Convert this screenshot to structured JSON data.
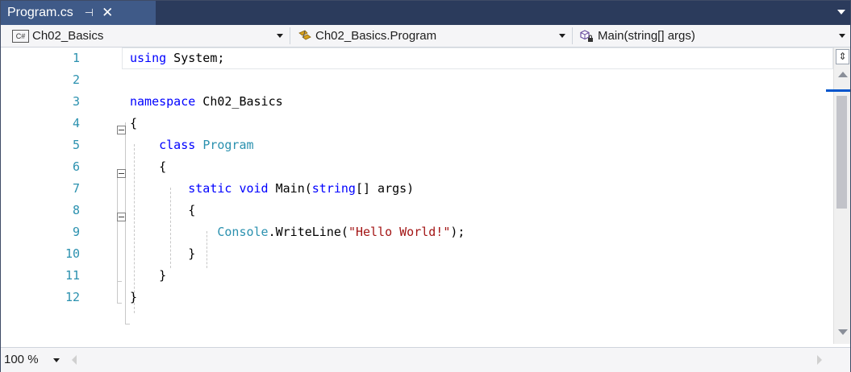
{
  "tab": {
    "title": "Program.cs",
    "pin_glyph": "⊣",
    "close_glyph": "✕"
  },
  "nav": {
    "project": {
      "icon": "csharp-project-icon",
      "badge": "C#",
      "label": "Ch02_Basics"
    },
    "type": {
      "icon": "class-icon",
      "label": "Ch02_Basics.Program"
    },
    "member": {
      "icon": "method-icon",
      "label": "Main(string[] args)"
    }
  },
  "editor": {
    "line_numbers": [
      "1",
      "2",
      "3",
      "4",
      "5",
      "6",
      "7",
      "8",
      "9",
      "10",
      "11",
      "12"
    ],
    "lines": [
      [
        {
          "t": "using",
          "c": "kw"
        },
        {
          "t": " System;",
          "c": ""
        }
      ],
      [],
      [
        {
          "t": "namespace",
          "c": "kw"
        },
        {
          "t": " Ch02_Basics",
          "c": ""
        }
      ],
      [
        {
          "t": "{",
          "c": ""
        }
      ],
      [
        {
          "t": "    ",
          "c": ""
        },
        {
          "t": "class",
          "c": "kw"
        },
        {
          "t": " ",
          "c": ""
        },
        {
          "t": "Program",
          "c": "ty"
        }
      ],
      [
        {
          "t": "    {",
          "c": ""
        }
      ],
      [
        {
          "t": "        ",
          "c": ""
        },
        {
          "t": "static",
          "c": "kw"
        },
        {
          "t": " ",
          "c": ""
        },
        {
          "t": "void",
          "c": "kw"
        },
        {
          "t": " Main(",
          "c": ""
        },
        {
          "t": "string",
          "c": "kw"
        },
        {
          "t": "[] args)",
          "c": ""
        }
      ],
      [
        {
          "t": "        {",
          "c": ""
        }
      ],
      [
        {
          "t": "            ",
          "c": ""
        },
        {
          "t": "Console",
          "c": "ty"
        },
        {
          "t": ".WriteLine(",
          "c": ""
        },
        {
          "t": "\"Hello World!\"",
          "c": "str"
        },
        {
          "t": ");",
          "c": ""
        }
      ],
      [
        {
          "t": "        }",
          "c": ""
        }
      ],
      [
        {
          "t": "    }",
          "c": ""
        }
      ],
      [
        {
          "t": "}",
          "c": ""
        }
      ]
    ]
  },
  "status": {
    "zoom": "100 %"
  },
  "colors": {
    "keyword": "#0000ff",
    "type": "#2b91af",
    "string": "#a31515",
    "line_number": "#2b91af",
    "tab_bg": "#3f5a88",
    "tabstrip_bg": "#2b3b5c"
  }
}
